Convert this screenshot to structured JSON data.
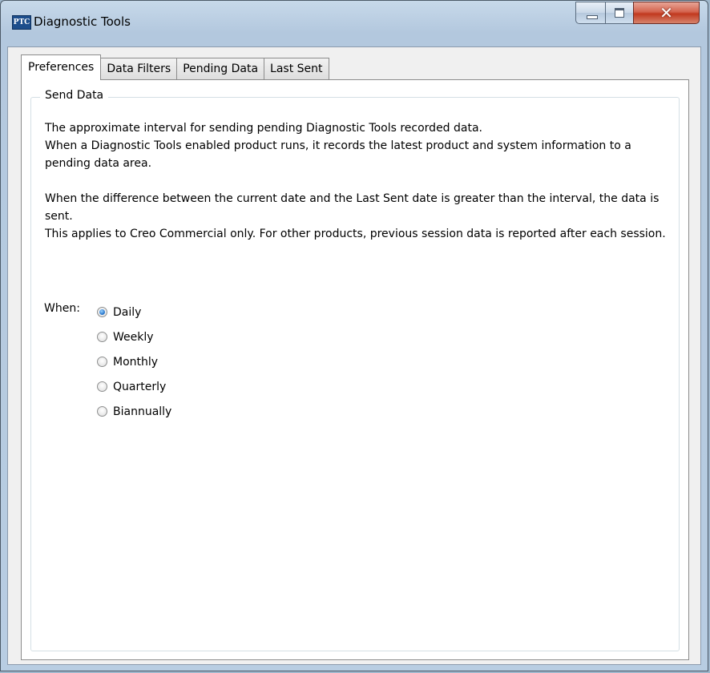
{
  "window": {
    "title": "Diagnostic Tools",
    "icon_text": "PTC"
  },
  "tabs": [
    {
      "label": "Preferences",
      "active": true
    },
    {
      "label": "Data Filters",
      "active": false
    },
    {
      "label": "Pending Data",
      "active": false
    },
    {
      "label": "Last Sent",
      "active": false
    }
  ],
  "send_data": {
    "group_label": "Send Data",
    "paragraph1_line1": "The approximate interval for sending pending Diagnostic Tools recorded data.",
    "paragraph1_line2": "When a Diagnostic Tools enabled product runs, it records the latest product and system information to a pending data area.",
    "paragraph2_line1": "When the difference between the current date and the Last Sent date is greater than the interval, the data is sent.",
    "paragraph2_line2": "This applies to Creo Commercial only. For other products, previous session data is reported after each session.",
    "when_label": "When:",
    "options": [
      {
        "label": "Daily",
        "selected": true
      },
      {
        "label": "Weekly",
        "selected": false
      },
      {
        "label": "Monthly",
        "selected": false
      },
      {
        "label": "Quarterly",
        "selected": false
      },
      {
        "label": "Biannually",
        "selected": false
      }
    ]
  }
}
